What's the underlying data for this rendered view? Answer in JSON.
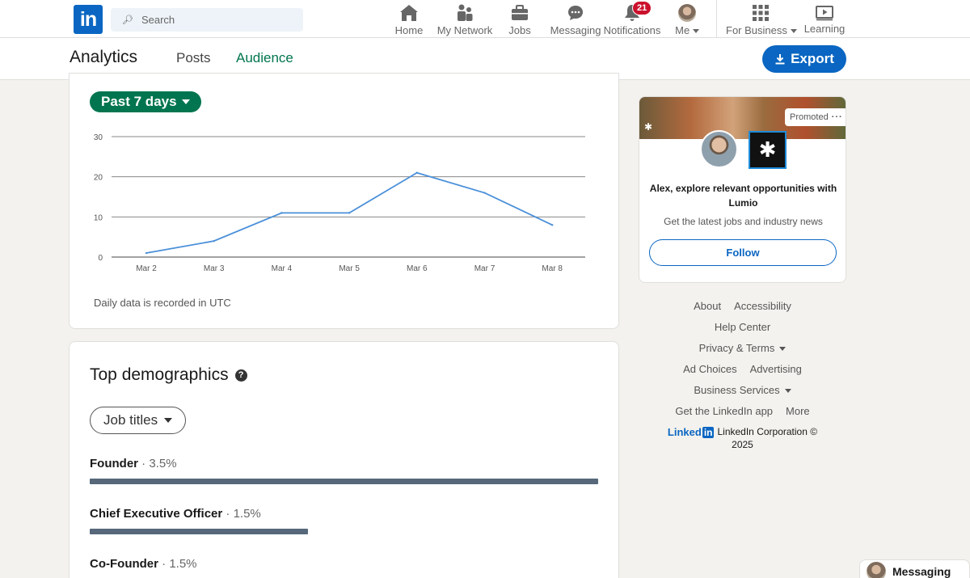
{
  "nav": {
    "search_placeholder": "Search",
    "items": [
      {
        "label": "Home",
        "icon": "home-icon"
      },
      {
        "label": "My Network",
        "icon": "network-icon"
      },
      {
        "label": "Jobs",
        "icon": "briefcase-icon"
      },
      {
        "label": "Messaging",
        "icon": "messaging-icon"
      },
      {
        "label": "Notifications",
        "icon": "bell-icon",
        "badge": "21"
      },
      {
        "label": "Me",
        "icon": "avatar"
      },
      {
        "label": "For Business",
        "icon": "grid-icon"
      },
      {
        "label": "Learning",
        "icon": "play-icon"
      }
    ]
  },
  "subheader": {
    "title": "Analytics",
    "tabs": [
      "Posts",
      "Audience"
    ],
    "active_tab": "Audience",
    "export_label": "Export"
  },
  "chart_card": {
    "range_label": "Past 7 days",
    "note": "Daily data is recorded in UTC"
  },
  "chart_data": {
    "type": "line",
    "categories": [
      "Mar 2",
      "Mar 3",
      "Mar 4",
      "Mar 5",
      "Mar 6",
      "Mar 7",
      "Mar 8"
    ],
    "values": [
      1,
      4,
      11,
      11,
      21,
      16,
      8
    ],
    "yticks": [
      0,
      10,
      20,
      30
    ],
    "ylim": [
      0,
      30
    ],
    "grid": true,
    "line_color": "#4a90d9"
  },
  "demographics": {
    "title": "Top demographics",
    "filter_label": "Job titles",
    "rows": [
      {
        "title": "Founder",
        "pct": "3.5%",
        "value": 3.5
      },
      {
        "title": "Chief Executive Officer",
        "pct": "1.5%",
        "value": 1.5
      },
      {
        "title": "Co-Founder",
        "pct": "1.5%",
        "value": 1.5
      }
    ]
  },
  "promo": {
    "badge": "Promoted",
    "headline": "Alex, explore relevant opportunities with Lumio",
    "sub": "Get the latest jobs and industry news",
    "follow_label": "Follow"
  },
  "footer": {
    "row1": [
      "About",
      "Accessibility"
    ],
    "row2": [
      "Help Center"
    ],
    "row3": [
      "Privacy & Terms"
    ],
    "row4": [
      "Ad Choices",
      "Advertising"
    ],
    "row5": [
      "Business Services"
    ],
    "row6": [
      "Get the LinkedIn app",
      "More"
    ],
    "brand": "Linked",
    "brand_box": "in",
    "corp": "LinkedIn Corporation ©",
    "year": "2025"
  },
  "messaging_tab": {
    "label": "Messaging"
  },
  "colors": {
    "brand": "#0a66c2",
    "accent_green": "#01754f",
    "bar": "#56687a"
  }
}
